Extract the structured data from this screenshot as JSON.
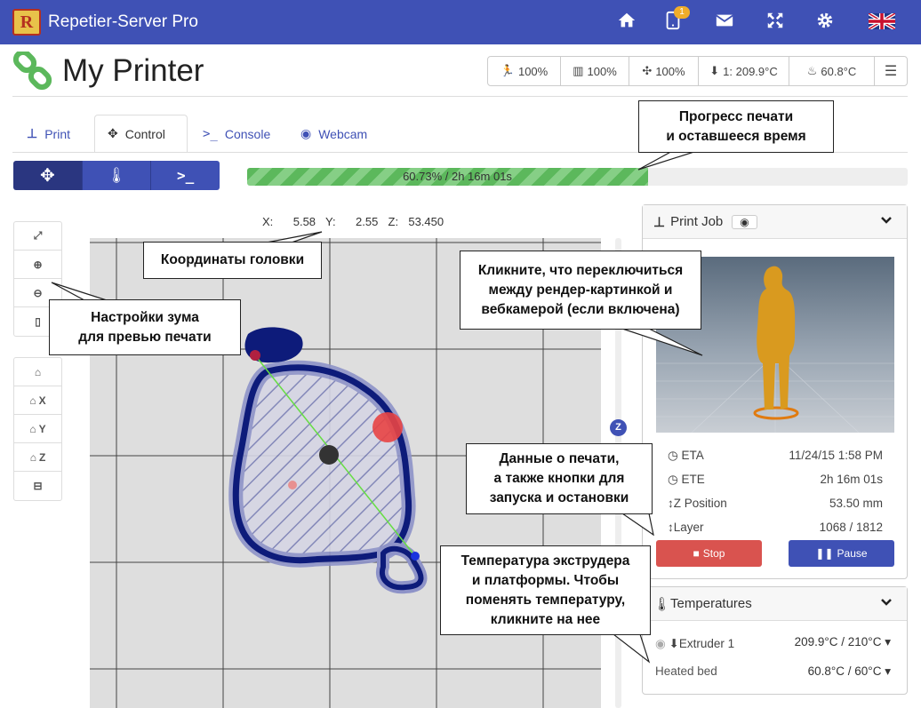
{
  "app": {
    "title": "Repetier-Server Pro",
    "logo_letter": "R",
    "notification_count": "1"
  },
  "printer": {
    "name": "My Printer"
  },
  "status": {
    "speed": "100%",
    "flow": "100%",
    "fan": "100%",
    "extruder": "1: 209.9°C",
    "bed": "60.8°C"
  },
  "tabs": [
    {
      "label": "Print"
    },
    {
      "label": "Control"
    },
    {
      "label": "Console"
    },
    {
      "label": "Webcam"
    }
  ],
  "progress": {
    "text": "60.73% / 2h 16m 01s",
    "fraction": 0.6073
  },
  "coords": {
    "text": "X:    5.58  Y:    2.55  Z:  53.450"
  },
  "left_toolbar": {
    "home_x": "X",
    "home_y": "Y",
    "home_z": "Z"
  },
  "z_marker": "Z",
  "print_job": {
    "title": "Print Job",
    "rows": [
      {
        "label": "ETA",
        "value": "11/24/15 1:58 PM"
      },
      {
        "label": "ETE",
        "value": "2h 16m 01s"
      },
      {
        "label": "Z Position",
        "value": "53.50 mm"
      },
      {
        "label": "Layer",
        "value": "1068 / 1812"
      }
    ],
    "stop_label": "Stop",
    "pause_label": "Pause"
  },
  "temperatures": {
    "title": "Temperatures",
    "extruder_label": "Extruder 1",
    "extruder_value": "209.9°C / 210°C",
    "bed_label": "Heated bed",
    "bed_value": "60.8°C / 60°C"
  },
  "callouts": {
    "progress": "Прогресс печати\nи оставшееся время",
    "coords": "Координаты головки",
    "zoom": "Настройки зума\nдля превью печати",
    "render": "Кликните, что переключиться\nмежду рендер-картинкой и\nвебкамерой (если включена)",
    "job": "Данные о печати,\nа также кнопки для\nзапуска и остановки",
    "temps": "Температура экструдера\nи платформы. Чтобы\nпоменять температуру,\nкликните на нее"
  }
}
